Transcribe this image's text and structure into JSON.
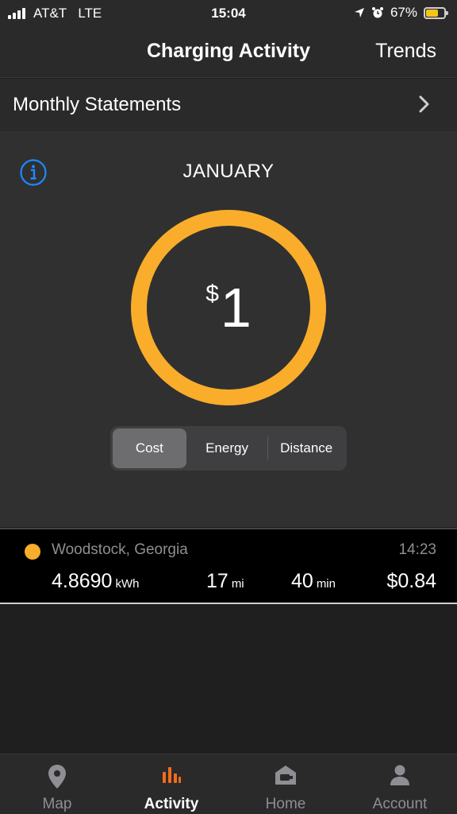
{
  "status_bar": {
    "carrier": "AT&T",
    "network": "LTE",
    "time": "15:04",
    "battery": "67%",
    "battery_level": 0.67
  },
  "nav": {
    "title": "Charging Activity",
    "right_button": "Trends"
  },
  "statements": {
    "label": "Monthly Statements"
  },
  "summary": {
    "month": "JANUARY",
    "currency_symbol": "$",
    "amount": "1",
    "ring_color": "#F9AD2A",
    "segments": [
      {
        "label": "Cost",
        "selected": true
      },
      {
        "label": "Energy",
        "selected": false
      },
      {
        "label": "Distance",
        "selected": false
      }
    ]
  },
  "session": {
    "location": "Woodstock, Georgia",
    "time": "14:23",
    "energy_value": "4.8690",
    "energy_unit": "kWh",
    "distance_value": "17",
    "distance_unit": "mi",
    "duration_value": "40",
    "duration_unit": "min",
    "cost": "$0.84",
    "dot_color": "#F9AD2A"
  },
  "tabs": [
    {
      "label": "Map",
      "icon": "map-pin-icon",
      "active": false
    },
    {
      "label": "Activity",
      "icon": "activity-bars-icon",
      "active": true
    },
    {
      "label": "Home",
      "icon": "home-charger-icon",
      "active": false
    },
    {
      "label": "Account",
      "icon": "person-icon",
      "active": false
    }
  ],
  "accent_color": "#F9AD2A",
  "info_color": "#1E88FF"
}
